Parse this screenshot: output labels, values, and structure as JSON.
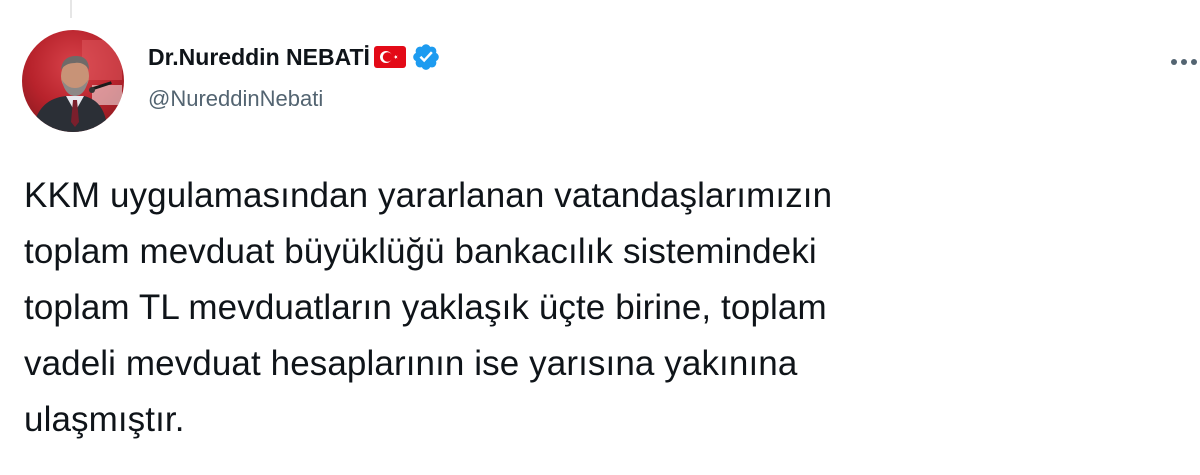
{
  "author": {
    "display_name": "Dr.Nureddin NEBATİ",
    "handle": "@NureddinNebati",
    "avatar_icon": "profile-photo",
    "flag_icon": "turkey-flag",
    "verified_icon": "verified-badge",
    "verified_color": "#1d9bf0"
  },
  "menu": {
    "icon": "more-options-icon"
  },
  "tweet": {
    "lines": [
      "KKM uygulamasından yararlanan vatandaşlarımızın",
      "toplam mevduat büyüklüğü bankacılık sistemindeki",
      "toplam TL mevduatların yaklaşık üçte birine, toplam",
      "vadeli mevduat hesaplarının ise yarısına yakınına",
      "ulaşmıştır."
    ]
  },
  "colors": {
    "text": "#0f1419",
    "secondary": "#536471",
    "flag_red": "#e30a17"
  }
}
